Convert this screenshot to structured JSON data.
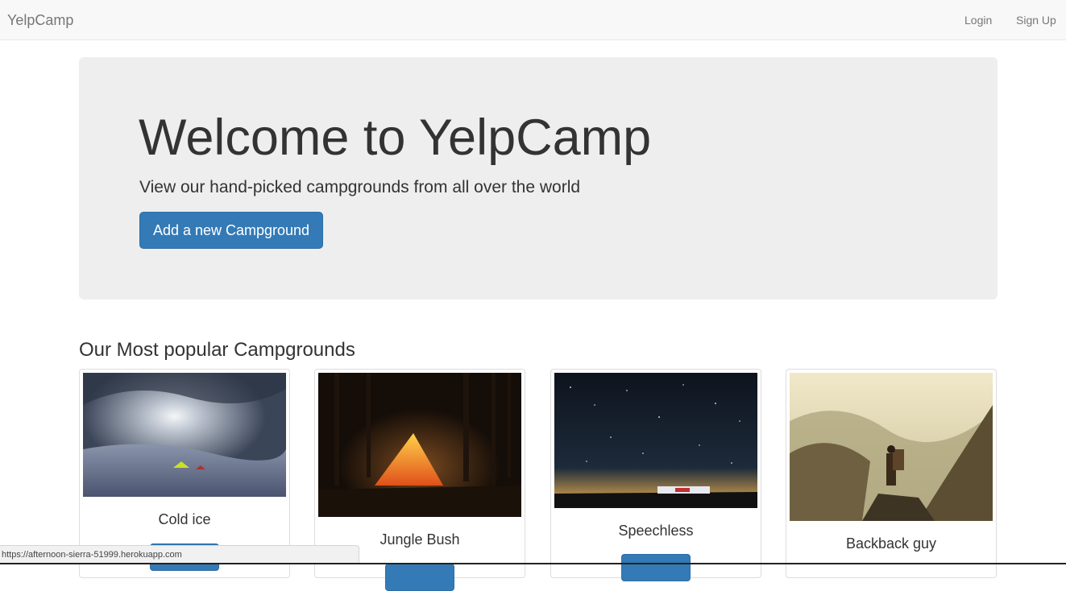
{
  "navbar": {
    "brand": "YelpCamp",
    "login": "Login",
    "signup": "Sign Up"
  },
  "jumbotron": {
    "title": "Welcome to YelpCamp",
    "subtitle": "View our hand-picked campgrounds from all over the world",
    "button": "Add a new Campground"
  },
  "section": {
    "title": "Our Most popular Campgrounds"
  },
  "campgrounds": [
    {
      "name": "Cold ice",
      "image": "snowy-tent-photo"
    },
    {
      "name": "Jungle Bush",
      "image": "glowing-tent-forest-photo"
    },
    {
      "name": "Speechless",
      "image": "starry-night-camp-photo"
    },
    {
      "name": "Backback guy",
      "image": "mountain-hiker-photo"
    }
  ],
  "status_bar": {
    "url": "https://afternoon-sierra-51999.herokuapp.com"
  },
  "colors": {
    "primary": "#337ab7",
    "jumbotron_bg": "#eeeeee",
    "navbar_bg": "#f8f8f8"
  }
}
